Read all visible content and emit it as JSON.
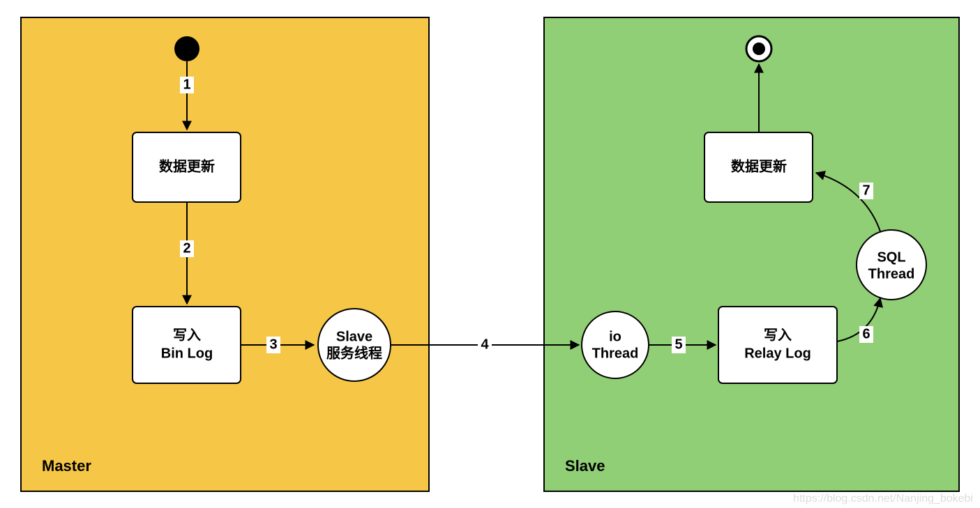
{
  "containers": {
    "master": {
      "label": "Master",
      "fill": "#f6c646"
    },
    "slave": {
      "label": "Slave",
      "fill": "#91cf76"
    }
  },
  "nodes": {
    "m_update": {
      "line1": "数据更新"
    },
    "m_binlog": {
      "line1": "写入",
      "line2": "Bin Log"
    },
    "slave_srv": {
      "line1": "Slave",
      "line2": "服务线程"
    },
    "io_thread": {
      "line1": "io",
      "line2": "Thread"
    },
    "relay_log": {
      "line1": "写入",
      "line2": "Relay Log"
    },
    "sql_thread": {
      "line1": "SQL",
      "line2": "Thread"
    },
    "s_update": {
      "line1": "数据更新"
    }
  },
  "edges": {
    "e1": "1",
    "e2": "2",
    "e3": "3",
    "e4": "4",
    "e5": "5",
    "e6": "6",
    "e7": "7"
  },
  "watermark": "https://blog.csdn.net/Nanjing_bokebi"
}
